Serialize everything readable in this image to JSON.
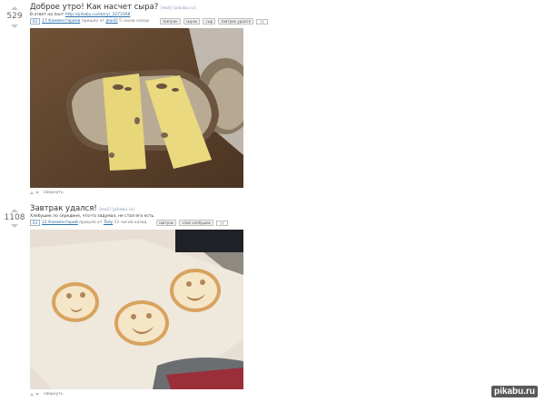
{
  "posts": [
    {
      "rating": "529",
      "title": "Доброе утро! Как насчет сыра?",
      "title_badges": "[моё] [pikabu.ru]",
      "reply_prefix": "В ответ на пост",
      "reply_link": "http://pikabu.ru/story/_3273308",
      "comments_count": "63",
      "comments_label": "17 Комментариев",
      "posted_prefix": "пришло от",
      "author": "JeanD",
      "time": "5 часов назад",
      "tags": [
        "завтрак",
        "сырок",
        "сыр",
        "завтрак удался"
      ],
      "collapse_label": "свернуть"
    },
    {
      "rating": "1108",
      "title": "Завтрак удался!",
      "title_badges": "[моё] [pikabu.ru]",
      "description": "Хлебушек по середине, что-то задумал, не стал его есть.",
      "comments_count": "63",
      "comments_label": "21 Комментарий",
      "posted_prefix": "пришло от",
      "author": "Tady",
      "time": "11 часов назад",
      "tags": [
        "завтрак",
        "злой хлебушек"
      ],
      "collapse_label": "свернуть"
    }
  ],
  "watermark": "pikabu.ru"
}
